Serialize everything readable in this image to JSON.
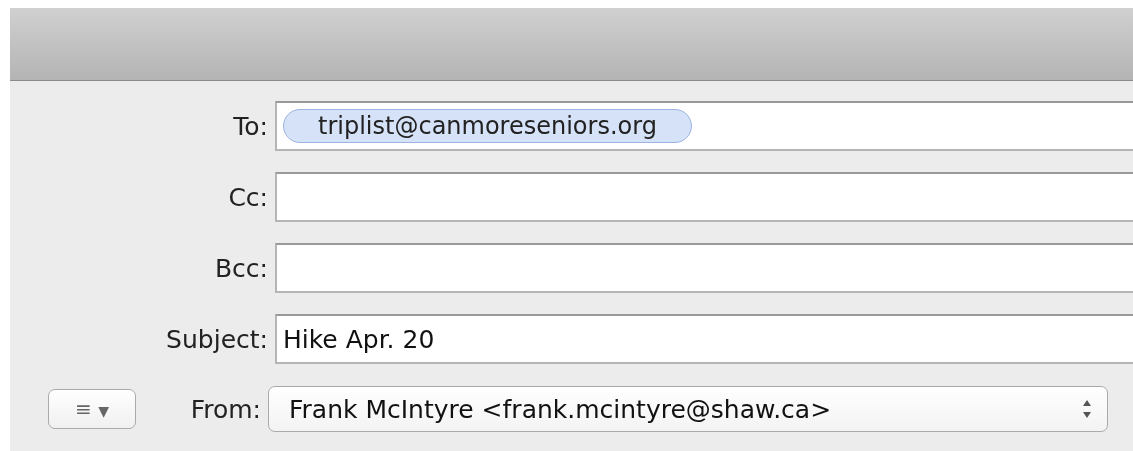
{
  "header_fields": [
    {
      "kind": "recipients",
      "label": "To:",
      "tokens": [
        "triplist@canmoreseniors.org"
      ]
    },
    {
      "kind": "recipients",
      "label": "Cc:"
    },
    {
      "kind": "recipients",
      "label": "Bcc:"
    },
    {
      "kind": "text",
      "label": "Subject:",
      "value": "Hike Apr. 20"
    }
  ],
  "format_menu": {
    "icon": "≡",
    "caret": "▼"
  },
  "from": {
    "label": "From:",
    "value": "Frank McIntyre <frank.mcintyre@shaw.ca>"
  }
}
